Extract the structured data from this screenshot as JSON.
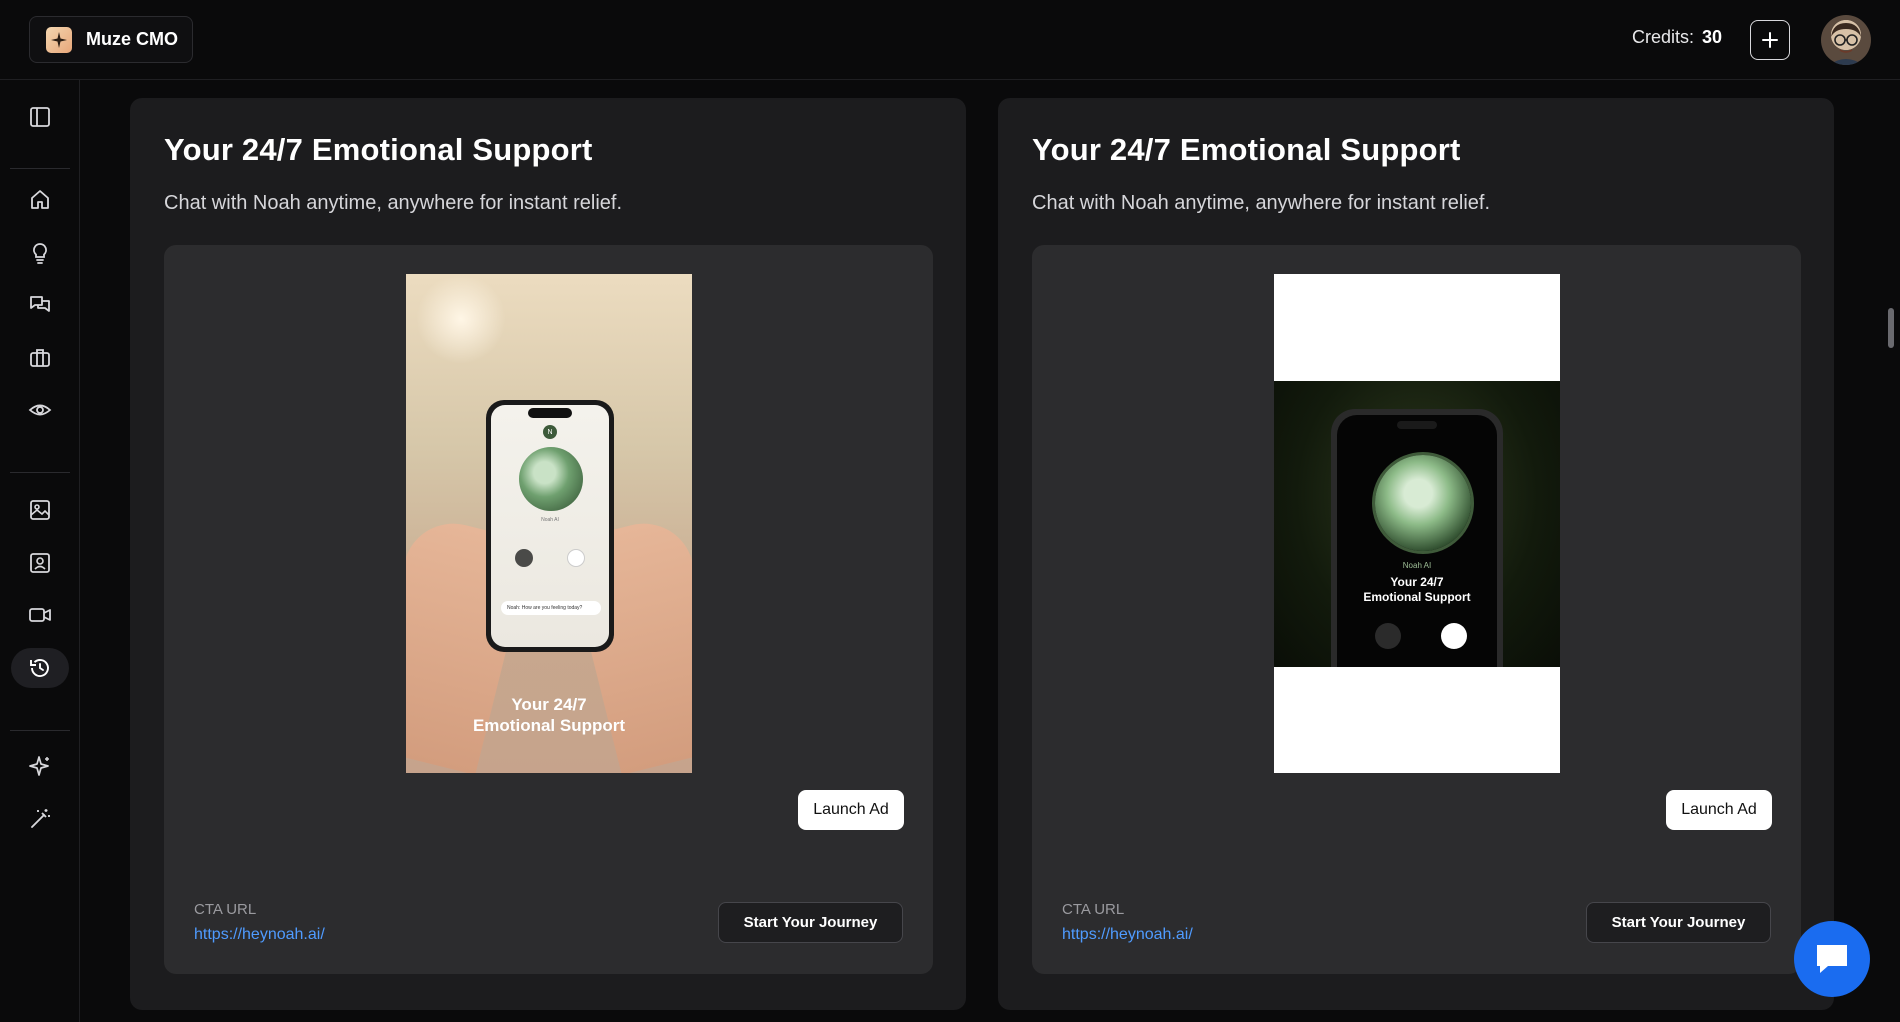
{
  "header": {
    "brand_name": "Muze CMO",
    "credits_label": "Credits:",
    "credits_value": "30"
  },
  "sidebar": {
    "items": [
      {
        "name": "sidebar-toggle",
        "icon": "sidebar-panel-icon"
      },
      {
        "name": "home",
        "icon": "home-icon"
      },
      {
        "name": "ideas",
        "icon": "lightbulb-icon"
      },
      {
        "name": "chat",
        "icon": "chat-bubbles-icon"
      },
      {
        "name": "briefcase",
        "icon": "briefcase-icon"
      },
      {
        "name": "view",
        "icon": "eye-icon"
      },
      {
        "name": "images",
        "icon": "image-icon"
      },
      {
        "name": "contacts",
        "icon": "contact-icon"
      },
      {
        "name": "video",
        "icon": "video-camera-icon"
      },
      {
        "name": "history",
        "icon": "history-icon",
        "active": true
      },
      {
        "name": "ai-sparkle",
        "icon": "sparkle-icon"
      },
      {
        "name": "magic",
        "icon": "magic-wand-icon"
      }
    ]
  },
  "cards": [
    {
      "title": "Your 24/7 Emotional Support",
      "subtitle": "Chat with Noah anytime, anywhere for instant relief.",
      "preview": {
        "caption_line1": "Your 24/7",
        "caption_line2": "Emotional Support",
        "app_name": "Noah AI",
        "chat_text": "Noah: How are you feeling today?"
      },
      "launch_label": "Launch Ad",
      "cta_label": "CTA URL",
      "cta_url": "https://heynoah.ai/",
      "cta_button": "Start Your Journey"
    },
    {
      "title": "Your 24/7 Emotional Support",
      "subtitle": "Chat with Noah anytime, anywhere for instant relief.",
      "preview": {
        "app_name": "Noah AI",
        "caption_line1": "Your 24/7",
        "caption_line2": "Emotional Support"
      },
      "launch_label": "Launch Ad",
      "cta_label": "CTA URL",
      "cta_url": "https://heynoah.ai/",
      "cta_button": "Start Your Journey"
    }
  ],
  "colors": {
    "background": "#0a0a0b",
    "card": "#1c1c1e",
    "inner": "#2c2c2e",
    "link": "#4f9bff",
    "fab": "#1a6cf0"
  }
}
